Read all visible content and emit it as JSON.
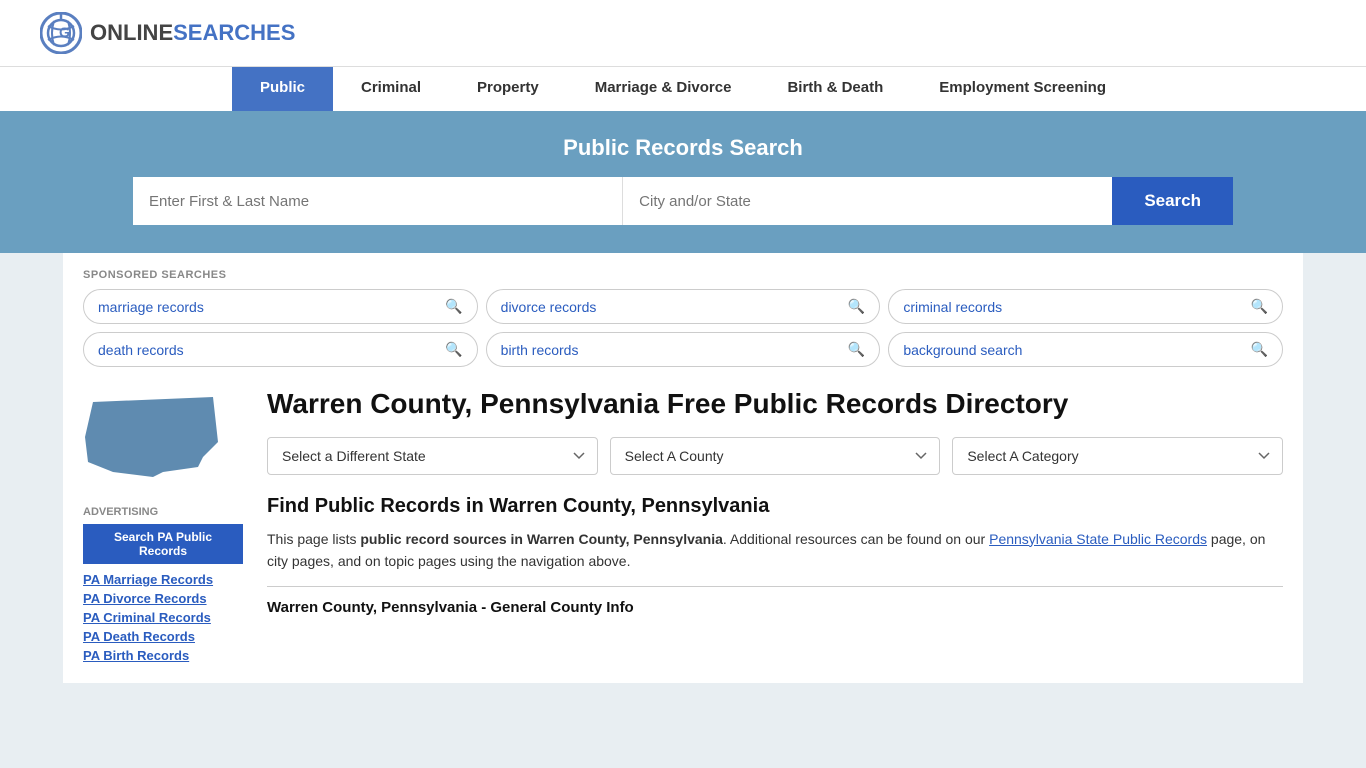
{
  "header": {
    "logo_online": "ONLINE",
    "logo_searches": "SEARCHES"
  },
  "nav": {
    "items": [
      {
        "id": "public",
        "label": "Public",
        "active": true
      },
      {
        "id": "criminal",
        "label": "Criminal",
        "active": false
      },
      {
        "id": "property",
        "label": "Property",
        "active": false
      },
      {
        "id": "marriage-divorce",
        "label": "Marriage & Divorce",
        "active": false
      },
      {
        "id": "birth-death",
        "label": "Birth & Death",
        "active": false
      },
      {
        "id": "employment",
        "label": "Employment Screening",
        "active": false
      }
    ]
  },
  "hero": {
    "title": "Public Records Search",
    "name_placeholder": "Enter First & Last Name",
    "location_placeholder": "City and/or State",
    "search_label": "Search"
  },
  "sponsored": {
    "label": "SPONSORED SEARCHES",
    "items": [
      {
        "id": "marriage",
        "label": "marriage records"
      },
      {
        "id": "divorce",
        "label": "divorce records"
      },
      {
        "id": "criminal",
        "label": "criminal records"
      },
      {
        "id": "death",
        "label": "death records"
      },
      {
        "id": "birth",
        "label": "birth records"
      },
      {
        "id": "background",
        "label": "background search"
      }
    ]
  },
  "county": {
    "title": "Warren County, Pennsylvania Free Public Records Directory",
    "dropdowns": {
      "state_label": "Select a Different State",
      "county_label": "Select A County",
      "category_label": "Select A Category"
    },
    "find_records_title": "Find Public Records in Warren County, Pennsylvania",
    "description_part1": "This page lists ",
    "description_bold": "public record sources in Warren County, Pennsylvania",
    "description_part2": ". Additional resources can be found on our ",
    "description_link": "Pennsylvania State Public Records",
    "description_part3": " page, on city pages, and on topic pages using the navigation above.",
    "general_info_title": "Warren County, Pennsylvania - General County Info"
  },
  "sidebar": {
    "advertising_label": "Advertising",
    "ad_button_label": "Search PA Public Records",
    "links": [
      {
        "id": "marriage",
        "label": "PA Marriage Records"
      },
      {
        "id": "divorce",
        "label": "PA Divorce Records"
      },
      {
        "id": "criminal",
        "label": "PA Criminal Records"
      },
      {
        "id": "death",
        "label": "PA Death Records"
      },
      {
        "id": "birth",
        "label": "PA Birth Records"
      }
    ]
  },
  "colors": {
    "hero_bg": "#6a9fc0",
    "nav_active": "#4472c4",
    "search_btn": "#2a5cbf",
    "pa_map": "#5f8bb0",
    "link": "#2a5cbf"
  }
}
